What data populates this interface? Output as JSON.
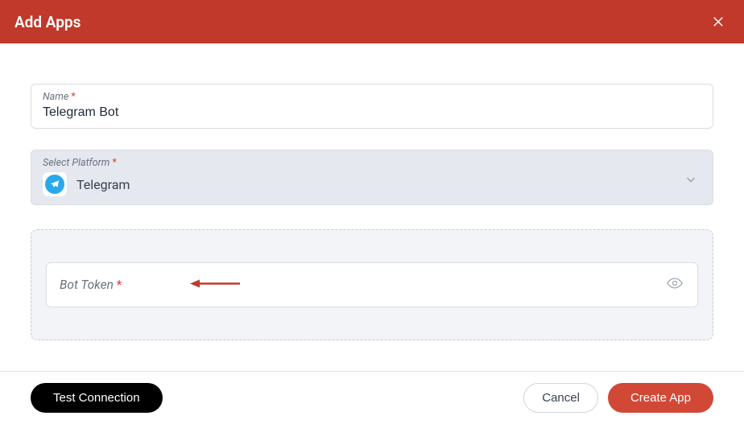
{
  "header": {
    "title": "Add Apps"
  },
  "form": {
    "name": {
      "label": "Name",
      "value": "Telegram Bot"
    },
    "platform": {
      "label": "Select Platform",
      "selected": "Telegram"
    },
    "botToken": {
      "label": "Bot Token",
      "value": ""
    }
  },
  "footer": {
    "test": "Test Connection",
    "cancel": "Cancel",
    "create": "Create App"
  }
}
